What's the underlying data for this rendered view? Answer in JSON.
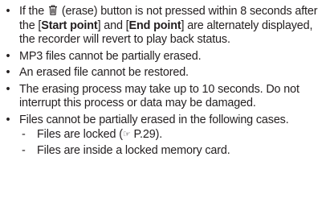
{
  "notes": [
    {
      "part1": "If the",
      "icon": "trash-icon",
      "part2": "(erase) button is not pressed within 8 seconds after the [",
      "bold1": "Start point",
      "part3": "] and [",
      "bold2": "End point",
      "part4": "] are alternately displayed, the recorder will revert to play back status."
    },
    {
      "text": "MP3 files cannot be partially erased."
    },
    {
      "text": "An erased file cannot be restored."
    },
    {
      "text": "The erasing process may take up to 10 seconds. Do not interrupt this process or data may be damaged."
    },
    {
      "text": "Files cannot be partially erased in the following cases.",
      "subitems": [
        {
          "text_before": "Files are locked (",
          "icon": "☞",
          "text_after": " P.29)."
        },
        {
          "text": "Files are inside a locked memory card."
        }
      ]
    }
  ],
  "bullet_char": "•",
  "dash_char": "-"
}
